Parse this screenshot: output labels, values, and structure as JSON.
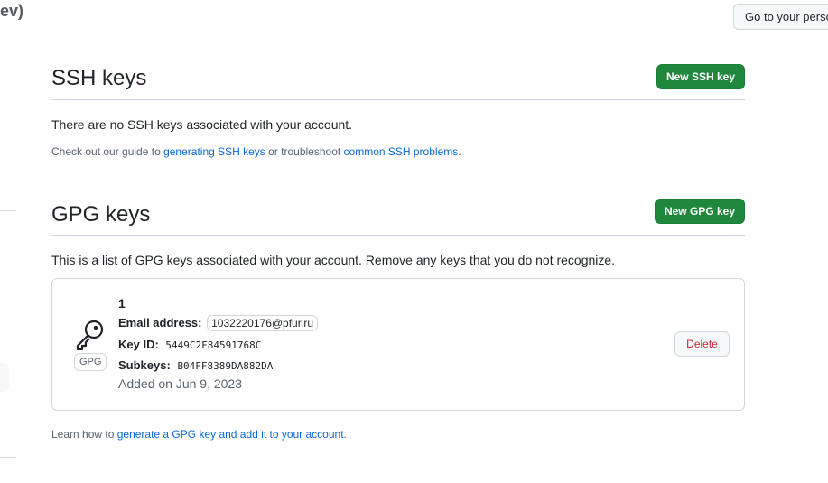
{
  "header": {
    "title_fragment": "ev)",
    "personal_button_label": "Go to your personal profile"
  },
  "ssh": {
    "title": "SSH keys",
    "new_button_label": "New SSH key",
    "empty_message": "There are no SSH keys associated with your account.",
    "guide_prefix": "Check out our guide to ",
    "guide_link1": "generating SSH keys",
    "guide_middle": " or troubleshoot ",
    "guide_link2": "common SSH problems",
    "guide_suffix": "."
  },
  "gpg": {
    "title": "GPG keys",
    "new_button_label": "New GPG key",
    "description": "This is a list of GPG keys associated with your account. Remove any keys that you do not recognize.",
    "keys": [
      {
        "badge": "GPG",
        "name": "1",
        "email_label": "Email address:",
        "email": "1032220176@pfur.ru",
        "key_id_label": "Key ID:",
        "key_id": "5449C2F84591768C",
        "subkeys_label": "Subkeys:",
        "subkeys": "B04FF8389DA882DA",
        "added": "Added on Jun 9, 2023",
        "delete_label": "Delete"
      }
    ],
    "learn_prefix": "Learn how to ",
    "learn_link": "generate a GPG key and add it to your account",
    "learn_suffix": "."
  },
  "icons": [
    "key-icon"
  ],
  "colors": {
    "primary_button": "#1f883d",
    "link": "#0969da",
    "danger": "#d1242f"
  }
}
